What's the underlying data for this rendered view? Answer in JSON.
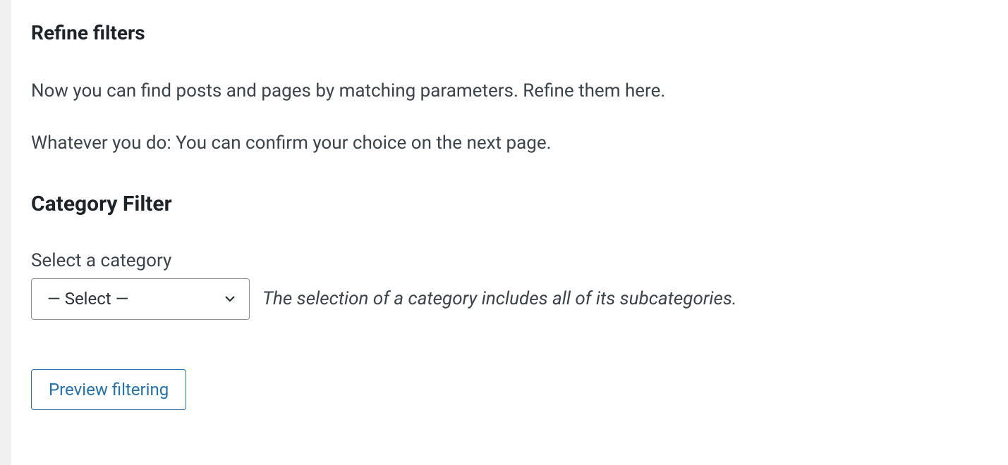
{
  "refine": {
    "heading": "Refine filters",
    "description1": "Now you can find posts and pages by matching parameters. Refine them here.",
    "description2": "Whatever you do: You can confirm your choice on the next page."
  },
  "category_filter": {
    "heading": "Category Filter",
    "label": "Select a category",
    "selected": "— Select —",
    "hint": "The selection of a category includes all of its subcategories."
  },
  "actions": {
    "preview_label": "Preview filtering"
  }
}
